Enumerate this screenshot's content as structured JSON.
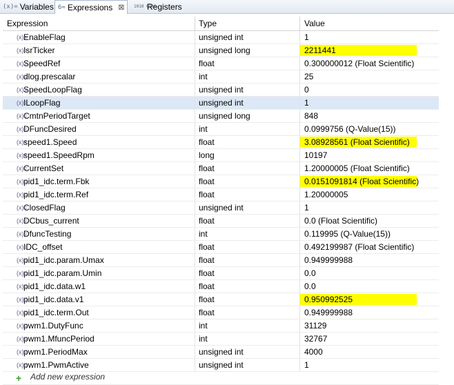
{
  "tabs": [
    {
      "icon": "(x)=",
      "label": "Variables",
      "active": false
    },
    {
      "icon": "6≈",
      "label": "Expressions",
      "active": true,
      "close": "⊠"
    },
    {
      "icon": "1010 0101",
      "label": "Registers",
      "active": false
    }
  ],
  "columns": {
    "expression": "Expression",
    "type": "Type",
    "value": "Value"
  },
  "var_icon": "(x)=",
  "highlight_color": "#ffff00",
  "rows": [
    {
      "expression": "EnableFlag",
      "type": "unsigned int",
      "value": "1",
      "highlight": false
    },
    {
      "expression": "IsrTicker",
      "type": "unsigned long",
      "value": "2211441",
      "highlight": true
    },
    {
      "expression": "SpeedRef",
      "type": "float",
      "value": "0.300000012 (Float Scientific)",
      "highlight": false
    },
    {
      "expression": "dlog.prescalar",
      "type": "int",
      "value": "25",
      "highlight": false
    },
    {
      "expression": "SpeedLoopFlag",
      "type": "unsigned int",
      "value": "0",
      "highlight": false
    },
    {
      "expression": "ILoopFlag",
      "type": "unsigned int",
      "value": "1",
      "highlight": false,
      "selected": true
    },
    {
      "expression": "CmtnPeriodTarget",
      "type": "unsigned long",
      "value": "848",
      "highlight": false
    },
    {
      "expression": "DFuncDesired",
      "type": "int",
      "value": "0.0999756 (Q-Value(15))",
      "highlight": false
    },
    {
      "expression": "speed1.Speed",
      "type": "float",
      "value": "3.08928561 (Float Scientific)",
      "highlight": true
    },
    {
      "expression": "speed1.SpeedRpm",
      "type": "long",
      "value": "10197",
      "highlight": false
    },
    {
      "expression": "CurrentSet",
      "type": "float",
      "value": "1.20000005 (Float Scientific)",
      "highlight": false
    },
    {
      "expression": "pid1_idc.term.Fbk",
      "type": "float",
      "value": "0.0151091814 (Float Scientific)",
      "highlight": true
    },
    {
      "expression": "pid1_idc.term.Ref",
      "type": "float",
      "value": "1.20000005",
      "highlight": false
    },
    {
      "expression": "ClosedFlag",
      "type": "unsigned int",
      "value": "1",
      "highlight": false
    },
    {
      "expression": "DCbus_current",
      "type": "float",
      "value": "0.0 (Float Scientific)",
      "highlight": false
    },
    {
      "expression": "DfuncTesting",
      "type": "int",
      "value": "0.119995 (Q-Value(15))",
      "highlight": false
    },
    {
      "expression": "IDC_offset",
      "type": "float",
      "value": "0.492199987 (Float Scientific)",
      "highlight": false
    },
    {
      "expression": "pid1_idc.param.Umax",
      "type": "float",
      "value": "0.949999988",
      "highlight": false
    },
    {
      "expression": "pid1_idc.param.Umin",
      "type": "float",
      "value": "0.0",
      "highlight": false
    },
    {
      "expression": "pid1_idc.data.w1",
      "type": "float",
      "value": "0.0",
      "highlight": false
    },
    {
      "expression": "pid1_idc.data.v1",
      "type": "float",
      "value": "0.950992525",
      "highlight": true
    },
    {
      "expression": "pid1_idc.term.Out",
      "type": "float",
      "value": "0.949999988",
      "highlight": false
    },
    {
      "expression": "pwm1.DutyFunc",
      "type": "int",
      "value": "31129",
      "highlight": false
    },
    {
      "expression": "pwm1.MfuncPeriod",
      "type": "int",
      "value": "32767",
      "highlight": false
    },
    {
      "expression": "pwm1.PeriodMax",
      "type": "unsigned int",
      "value": "4000",
      "highlight": false
    },
    {
      "expression": "pwm1.PwmActive",
      "type": "unsigned int",
      "value": "1",
      "highlight": false
    }
  ],
  "add_new": {
    "icon": "+",
    "label": "Add new expression"
  }
}
